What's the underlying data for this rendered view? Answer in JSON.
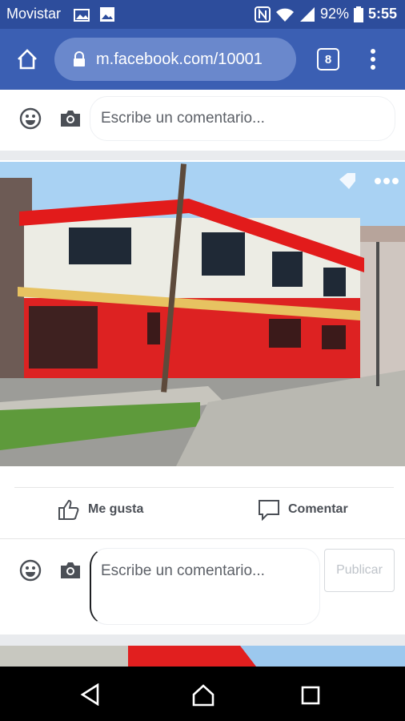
{
  "status": {
    "carrier": "Movistar",
    "battery": "92%",
    "time": "5:55"
  },
  "browser": {
    "url": "m.facebook.com/10001",
    "tab_count": "8"
  },
  "comment_box_top": {
    "placeholder": "Escribe un comentario..."
  },
  "post": {
    "actions": {
      "like_label": "Me gusta",
      "comment_label": "Comentar"
    }
  },
  "comment_box_bottom": {
    "placeholder": "Escribe un comentario...",
    "publish_label": "Publicar"
  },
  "colors": {
    "status_bar": "#2d4d9c",
    "url_bar": "#3b5fb3",
    "publish_disabled": "#bec3c9"
  }
}
